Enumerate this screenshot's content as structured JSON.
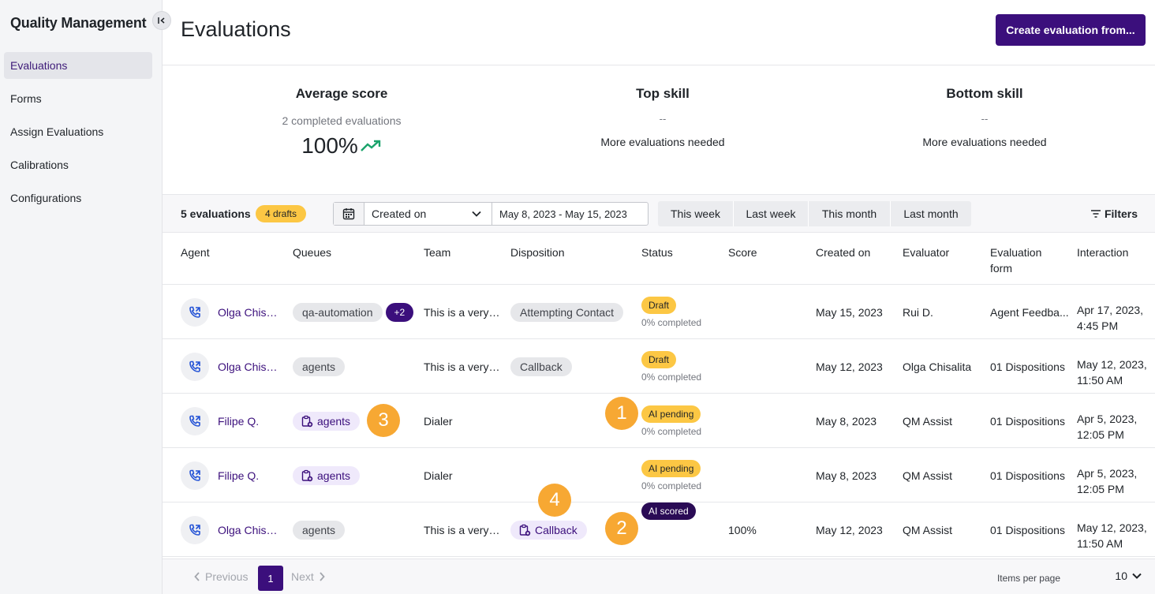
{
  "sidebar": {
    "title": "Quality Management",
    "items": [
      {
        "label": "Evaluations",
        "active": true
      },
      {
        "label": "Forms"
      },
      {
        "label": "Assign Evaluations"
      },
      {
        "label": "Calibrations"
      },
      {
        "label": "Configurations"
      }
    ]
  },
  "header": {
    "title": "Evaluations",
    "create_button": "Create evaluation from..."
  },
  "summary": {
    "average": {
      "title": "Average score",
      "sub": "2 completed evaluations",
      "value": "100%",
      "icon": "trending-up-icon"
    },
    "top_skill": {
      "title": "Top skill",
      "value": "--",
      "note": "More evaluations needed"
    },
    "bottom_skill": {
      "title": "Bottom skill",
      "value": "--",
      "note": "More evaluations needed"
    }
  },
  "toolbar": {
    "count": "5 evaluations",
    "drafts": "4 drafts",
    "date_field": "Created on",
    "date_range": "May 8, 2023 - May 15, 2023",
    "ranges": [
      "This week",
      "Last week",
      "This month",
      "Last month"
    ],
    "filters": "Filters"
  },
  "table": {
    "headers": [
      "Agent",
      "Queues",
      "Team",
      "Disposition",
      "Status",
      "Score",
      "Created on",
      "Evaluator",
      "Evaluation form",
      "Interaction"
    ],
    "rows": [
      {
        "agent": "Olga Chisal...",
        "queue": "qa-automation",
        "queue_extra": "+2",
        "team": "This is a very l...",
        "disposition": "Attempting Contact",
        "status": "Draft",
        "status_sub": "0% completed",
        "score": "",
        "created": "May 15, 2023",
        "evaluator": "Rui D.",
        "form": "Agent Feedba...",
        "interaction_1": "Apr 17, 2023,",
        "interaction_2": "4:45 PM"
      },
      {
        "agent": "Olga Chisal...",
        "queue": "agents",
        "queue_extra": "",
        "team": "This is a very l...",
        "disposition": "Callback",
        "status": "Draft",
        "status_sub": "0% completed",
        "score": "",
        "created": "May 12, 2023",
        "evaluator": "Olga Chisalita",
        "form": "01 Dispositions",
        "interaction_1": "May 12, 2023,",
        "interaction_2": "11:50 AM"
      },
      {
        "agent": "Filipe Q.",
        "queue": "agents",
        "queue_extra": "",
        "team": "Dialer",
        "disposition": "",
        "status": "AI pending",
        "status_sub": "0% completed",
        "score": "",
        "created": "May 8, 2023",
        "evaluator": "QM Assist",
        "form": "01 Dispositions",
        "interaction_1": "Apr 5, 2023,",
        "interaction_2": "12:05 PM"
      },
      {
        "agent": "Filipe Q.",
        "queue": "agents",
        "queue_extra": "",
        "team": "Dialer",
        "disposition": "",
        "status": "AI pending",
        "status_sub": "0% completed",
        "score": "",
        "created": "May 8, 2023",
        "evaluator": "QM Assist",
        "form": "01 Dispositions",
        "interaction_1": "Apr 5, 2023,",
        "interaction_2": "12:05 PM"
      },
      {
        "agent": "Olga Chisal...",
        "queue": "agents",
        "queue_extra": "",
        "team": "This is a very l...",
        "disposition": "Callback",
        "status": "AI scored",
        "status_sub": "",
        "score": "100%",
        "created": "May 12, 2023",
        "evaluator": "QM Assist",
        "form": "01 Dispositions",
        "interaction_1": "May 12, 2023,",
        "interaction_2": "11:50 AM"
      }
    ]
  },
  "markers": [
    "1",
    "2",
    "3",
    "4"
  ],
  "pagination": {
    "previous": "Previous",
    "page": "1",
    "next": "Next",
    "items_label": "Items per page",
    "items_value": "10"
  },
  "colors": {
    "brand": "#3b0f7c",
    "draft": "#fcc744",
    "scored": "#2a0b55",
    "marker": "#f7a833",
    "trend": "#1aa36b",
    "call_icon": "#2453d6"
  }
}
